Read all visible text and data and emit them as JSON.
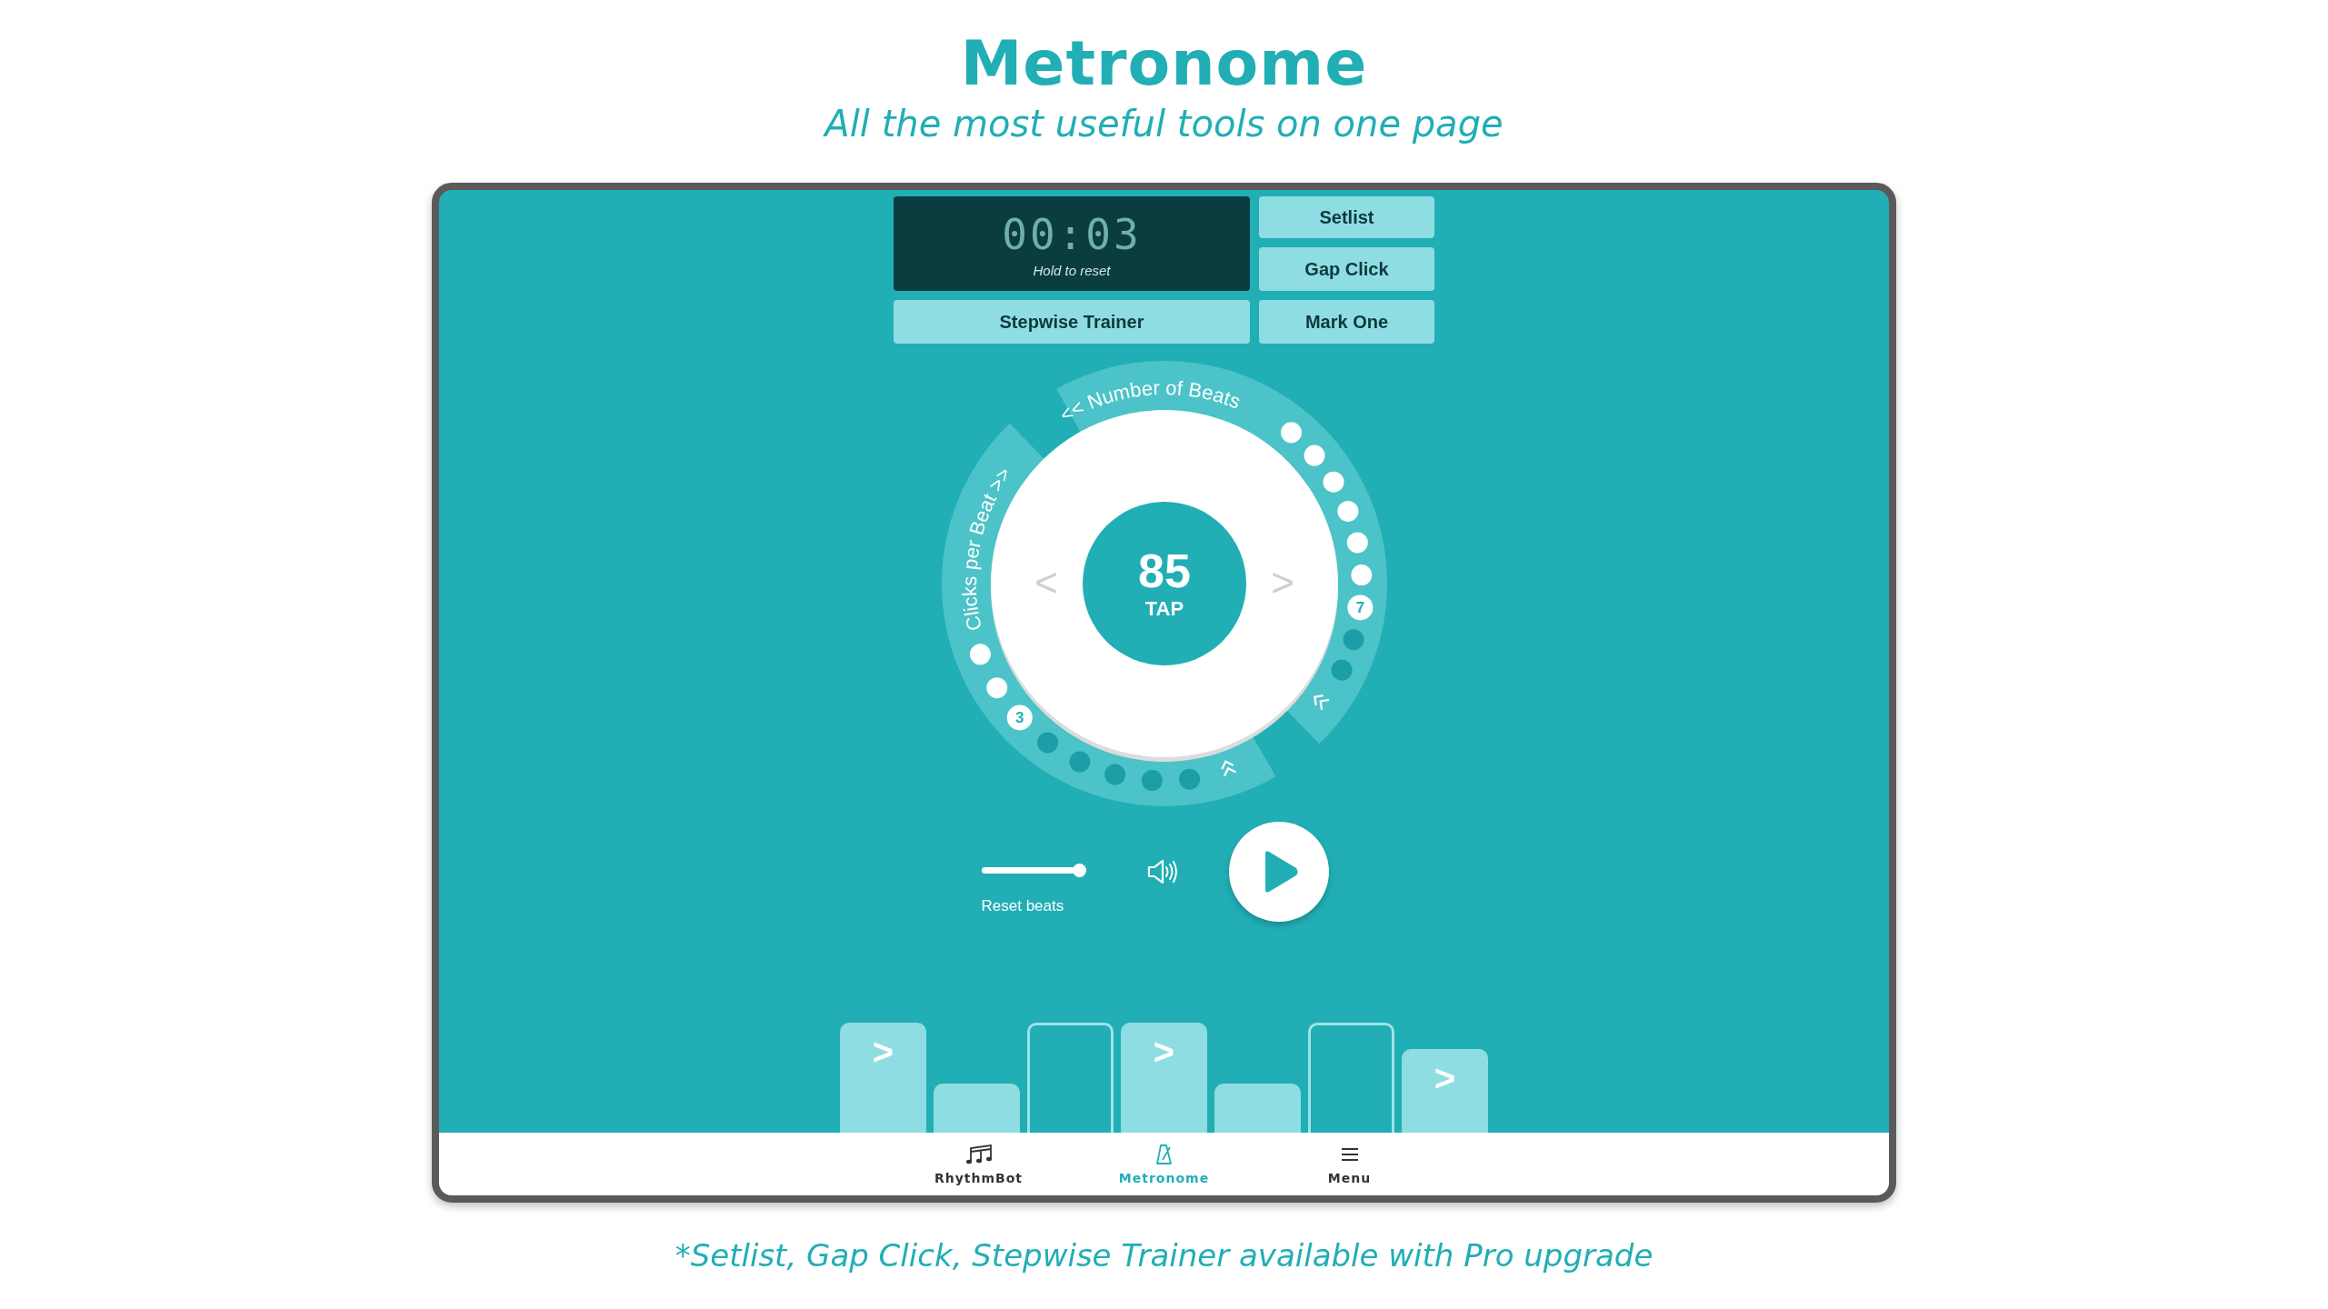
{
  "header": {
    "title": "Metronome",
    "subtitle": "All the most useful tools on one page"
  },
  "timer": {
    "time": "00:03",
    "hint": "Hold to reset"
  },
  "tool_buttons": [
    {
      "label": "Setlist"
    },
    {
      "label": "Gap Click"
    },
    {
      "label": "Stepwise Trainer"
    },
    {
      "label": "Mark One"
    }
  ],
  "dial": {
    "tempo": "85",
    "tap_label": "TAP",
    "prev": "<",
    "next": ">",
    "beats": {
      "label": "<< Number of Beats",
      "dots": [
        {
          "on": true,
          "selected": false
        },
        {
          "on": true,
          "selected": false
        },
        {
          "on": true,
          "selected": false
        },
        {
          "on": true,
          "selected": false
        },
        {
          "on": true,
          "selected": false
        },
        {
          "on": true,
          "selected": false
        },
        {
          "on": true,
          "selected": true,
          "number": "7"
        },
        {
          "on": false,
          "selected": false
        },
        {
          "on": false,
          "selected": false
        }
      ]
    },
    "clicks": {
      "label": "Clicks per Beat >>",
      "dots": [
        {
          "on": true,
          "selected": false
        },
        {
          "on": true,
          "selected": false
        },
        {
          "on": true,
          "selected": true,
          "number": "3"
        },
        {
          "on": false,
          "selected": false
        },
        {
          "on": false,
          "selected": false
        },
        {
          "on": false,
          "selected": false
        },
        {
          "on": false,
          "selected": false
        },
        {
          "on": false,
          "selected": false
        }
      ]
    }
  },
  "transport": {
    "volume": {
      "level": 1
    },
    "reset_label": "Reset beats",
    "playing": false
  },
  "beat_bars": [
    {
      "kind": "accent",
      "mark": ">"
    },
    {
      "kind": "normal"
    },
    {
      "kind": "silent"
    },
    {
      "kind": "accent",
      "mark": ">"
    },
    {
      "kind": "normal"
    },
    {
      "kind": "silent"
    },
    {
      "kind": "soft_accent",
      "mark": ">"
    }
  ],
  "nav": [
    {
      "label": "RhythmBot",
      "selected": false
    },
    {
      "label": "Metronome",
      "selected": true
    },
    {
      "label": "Menu",
      "selected": false
    }
  ],
  "footer": "*Setlist, Gap Click, Stepwise Trainer available with Pro upgrade"
}
